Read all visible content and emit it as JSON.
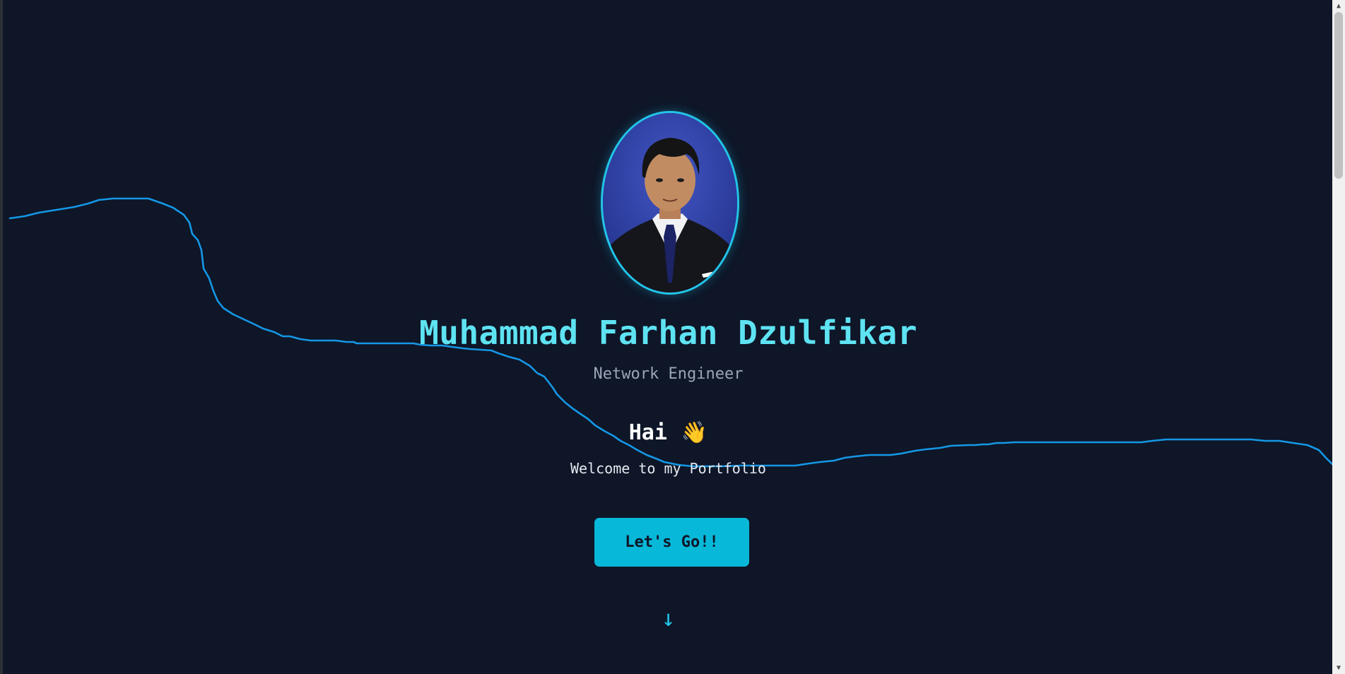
{
  "hero": {
    "name": "Muhammad Farhan Dzulfikar",
    "role": "Network Engineer",
    "greeting": "Hai",
    "greeting_emoji": "👋",
    "welcome": "Welcome to my Portfolio",
    "cta_label": "Let's Go!!",
    "scroll_indicator": "↓",
    "avatar_alt": "Muhammad Farhan Dzulfikar"
  },
  "theme": {
    "background": "#0e1628",
    "accent": "#22c5e8",
    "name_color": "#5ee3f2",
    "button_color": "#08b8d8",
    "wave_color": "#1597e5"
  },
  "icons": {
    "scroll_up": "▲",
    "scroll_down": "▼"
  }
}
